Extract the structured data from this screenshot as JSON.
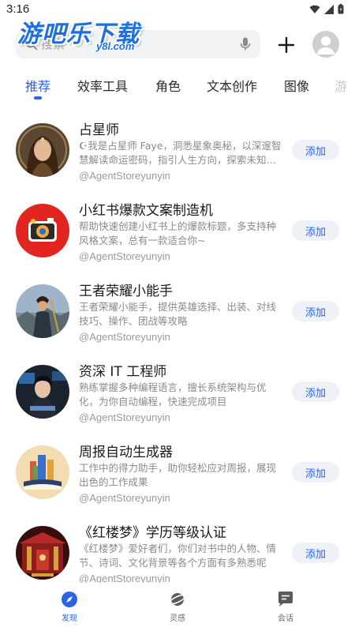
{
  "status_bar": {
    "time": "3:16"
  },
  "watermark": {
    "main": "游吧乐下载",
    "sub": "y8l.com"
  },
  "search": {
    "placeholder": "搜索"
  },
  "tabs": [
    {
      "label": "推荐",
      "active": true
    },
    {
      "label": "效率工具",
      "active": false
    },
    {
      "label": "角色",
      "active": false
    },
    {
      "label": "文本创作",
      "active": false
    },
    {
      "label": "图像",
      "active": false
    },
    {
      "label": "游",
      "active": false
    }
  ],
  "items": [
    {
      "title": "占星师",
      "description": "☪我是占星师 Faye，洞悉星象奥秘，以深邃智慧解读命运密码，指引人生方向，探索未知之旅",
      "author": "@AgentStoreyunyin",
      "button": "添加",
      "avatar_icon": "astrologer-portrait-icon"
    },
    {
      "title": "小红书爆款文案制造机",
      "description": "帮助快速创建小红书上的爆款标题，多支持种风格文案，总有一款适合你~",
      "author": "@AgentStoreyunyin",
      "button": "添加",
      "avatar_icon": "red-camera-icon"
    },
    {
      "title": "王者荣耀小能手",
      "description": "王者荣耀小能手，提供英雄选择、出装、对线技巧、操作、团战等攻略",
      "author": "@AgentStoreyunyin",
      "button": "添加",
      "avatar_icon": "warrior-portrait-icon"
    },
    {
      "title": "资深 IT 工程师",
      "description": "熟练掌握多种编程语言，擅长系统架构与优化，为你自动编程，快速完成项目",
      "author": "@AgentStoreyunyin",
      "button": "添加",
      "avatar_icon": "engineer-portrait-icon"
    },
    {
      "title": "周报自动生成器",
      "description": "工作中的得力助手，助你轻松应对周报，展现出色的工作成果",
      "author": "@AgentStoreyunyin",
      "button": "添加",
      "avatar_icon": "book-city-icon"
    },
    {
      "title": "《红楼梦》学历等级认证",
      "description": "《红楼梦》爱好者们，你们对书中的人物、情节、诗词、文化背景等各个方面有多熟悉呢",
      "author": "@AgentStoreyunyin",
      "button": "添加",
      "avatar_icon": "red-mansion-icon"
    }
  ],
  "bottom_nav": [
    {
      "label": "发现",
      "icon": "compass-icon",
      "active": true
    },
    {
      "label": "灵感",
      "icon": "planet-icon",
      "active": false
    },
    {
      "label": "会话",
      "icon": "chat-icon",
      "active": false
    }
  ],
  "colors": {
    "accent": "#2a63e8",
    "watermark": "#1e6fe0",
    "button_bg": "#eef1f7"
  }
}
